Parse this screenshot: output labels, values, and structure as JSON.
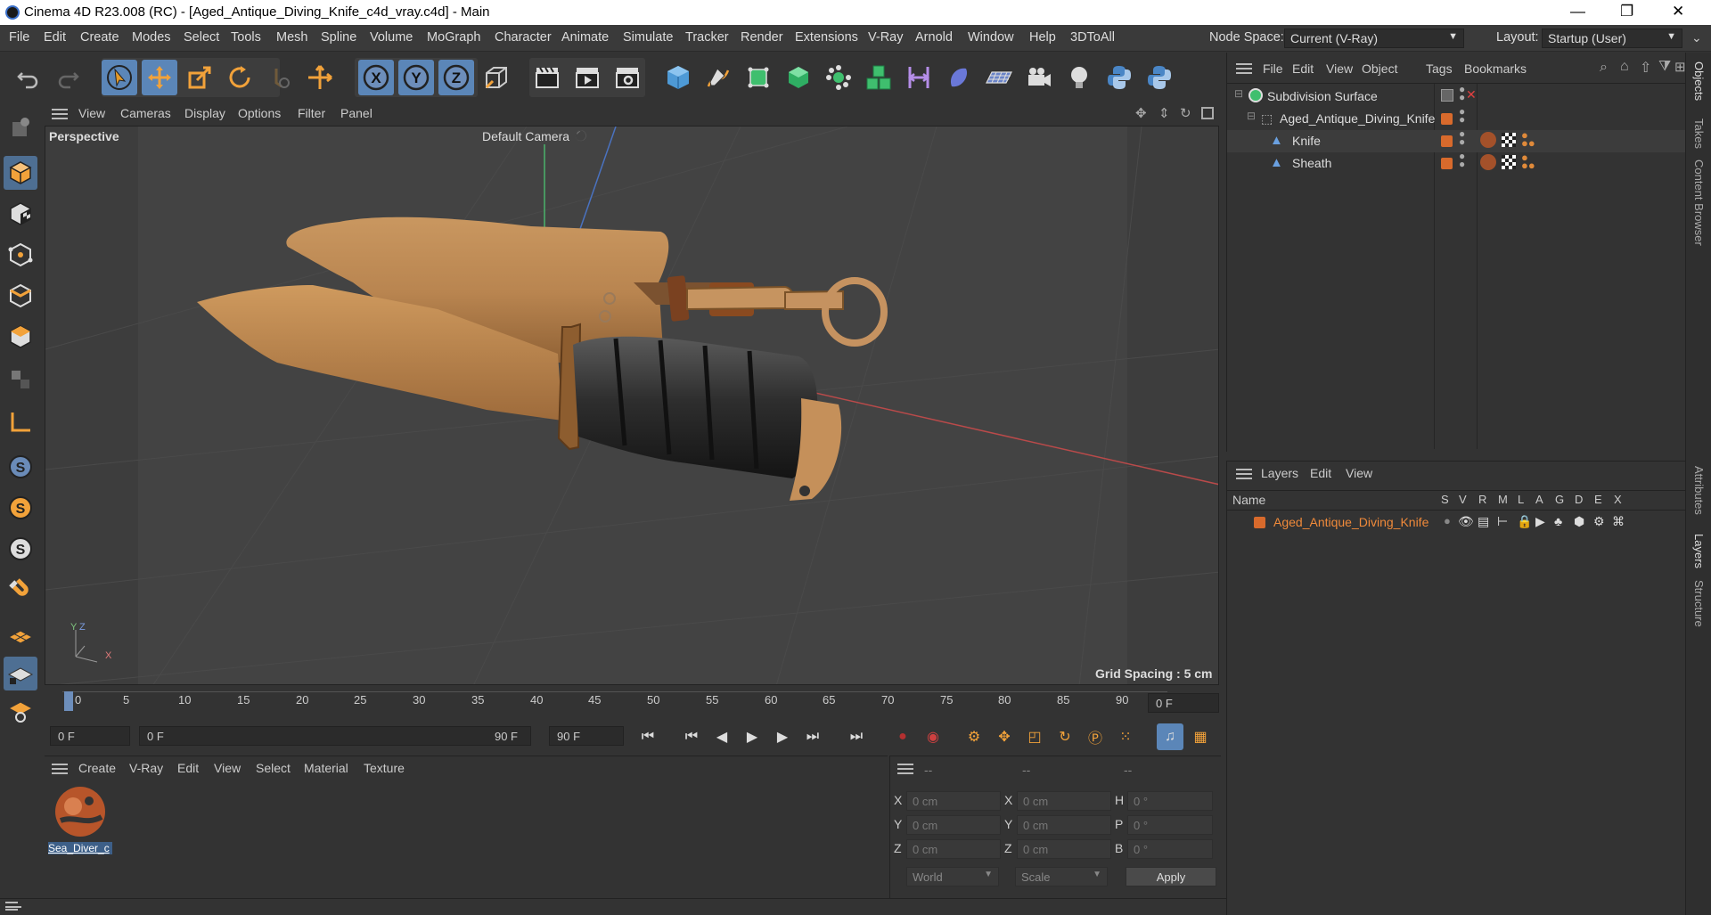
{
  "window": {
    "title": "Cinema 4D R23.008 (RC) - [Aged_Antique_Diving_Knife_c4d_vray.c4d] - Main",
    "minimize": "—",
    "maximize": "❐",
    "close": "✕"
  },
  "menubar": {
    "items": [
      "File",
      "Edit",
      "Create",
      "Modes",
      "Select",
      "Tools",
      "Mesh",
      "Spline",
      "Volume",
      "MoGraph",
      "Character",
      "Animate",
      "Simulate",
      "Tracker",
      "Render",
      "Extensions",
      "V-Ray",
      "Arnold",
      "Window",
      "Help",
      "3DToAll"
    ],
    "node_space_label": "Node Space:",
    "node_space_value": "Current (V-Ray)",
    "layout_label": "Layout:",
    "layout_value": "Startup (User)"
  },
  "viewport": {
    "menu": [
      "View",
      "Cameras",
      "Display",
      "Options",
      "Filter",
      "Panel"
    ],
    "name": "Perspective",
    "camera": "Default Camera",
    "grid_spacing": "Grid Spacing : 5 cm",
    "axis_y": "Y",
    "axis_z": "Z",
    "axis_x": "X"
  },
  "timeline": {
    "ticks": [
      "0",
      "5",
      "10",
      "15",
      "20",
      "25",
      "30",
      "35",
      "40",
      "45",
      "50",
      "55",
      "60",
      "65",
      "70",
      "75",
      "80",
      "85",
      "90"
    ],
    "current_frame": "0 F"
  },
  "playback": {
    "start": "0 F",
    "range_start": "0 F",
    "range_end": "90 F",
    "end": "90 F"
  },
  "material_manager": {
    "menu": [
      "Create",
      "V-Ray",
      "Edit",
      "View",
      "Select",
      "Material",
      "Texture"
    ],
    "materials": [
      {
        "name": "Sea_Diver_c"
      }
    ]
  },
  "coordinates": {
    "headers": [
      "--",
      "--",
      "--"
    ],
    "rows": [
      {
        "l1": "X",
        "v1": "0 cm",
        "l2": "X",
        "v2": "0 cm",
        "l3": "H",
        "v3": "0 °"
      },
      {
        "l1": "Y",
        "v1": "0 cm",
        "l2": "Y",
        "v2": "0 cm",
        "l3": "P",
        "v3": "0 °"
      },
      {
        "l1": "Z",
        "v1": "0 cm",
        "l2": "Z",
        "v2": "0 cm",
        "l3": "B",
        "v3": "0 °"
      }
    ],
    "space": "World",
    "mode": "Scale",
    "apply": "Apply"
  },
  "object_manager": {
    "menu": [
      "File",
      "Edit",
      "View",
      "Object",
      "Tags",
      "Bookmarks"
    ],
    "objects": [
      {
        "name": "Subdivision Surface"
      },
      {
        "name": "Aged_Antique_Diving_Knife"
      },
      {
        "name": "Knife"
      },
      {
        "name": "Sheath"
      }
    ]
  },
  "layer_manager": {
    "menu": [
      "Layers",
      "Edit",
      "View"
    ],
    "name_header": "Name",
    "columns": [
      "S",
      "V",
      "R",
      "M",
      "L",
      "A",
      "G",
      "D",
      "E",
      "X"
    ],
    "layers": [
      {
        "name": "Aged_Antique_Diving_Knife"
      }
    ]
  },
  "side_tabs": [
    "Objects",
    "Takes",
    "Content Browser",
    "Attributes",
    "Layers",
    "Structure"
  ],
  "colors": {
    "accent": "#5b86b8",
    "layer": "#d86a2c",
    "background": "#333333"
  }
}
